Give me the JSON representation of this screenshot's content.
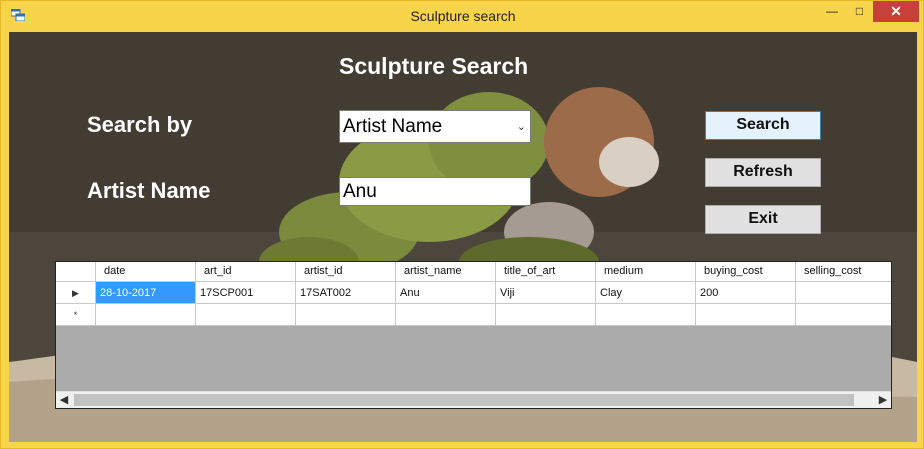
{
  "window": {
    "title": "Sculpture search",
    "controls": {
      "minimize_icon": "minimize-icon",
      "maximize_icon": "maximize-icon",
      "close_icon": "close-icon"
    }
  },
  "form": {
    "heading": "Sculpture Search",
    "search_by_label": "Search by",
    "search_by_value": "Artist Name",
    "artist_name_label": "Artist Name",
    "artist_name_value": "Anu"
  },
  "buttons": {
    "search": "Search",
    "refresh": "Refresh",
    "exit": "Exit"
  },
  "grid": {
    "columns": [
      "date",
      "art_id",
      "artist_id",
      "artist_name",
      "title_of_art",
      "medium",
      "buying_cost",
      "selling_cost"
    ],
    "rows": [
      [
        "28-10-2017",
        "17SCP001",
        "17SAT002",
        "Anu",
        "Viji",
        "Clay",
        "200",
        ""
      ]
    ],
    "current_row_marker": "▶",
    "new_row_marker": "*"
  },
  "colors": {
    "window_frame": "#f7d44a",
    "close_button": "#c7413a",
    "selection": "#3399ff"
  }
}
